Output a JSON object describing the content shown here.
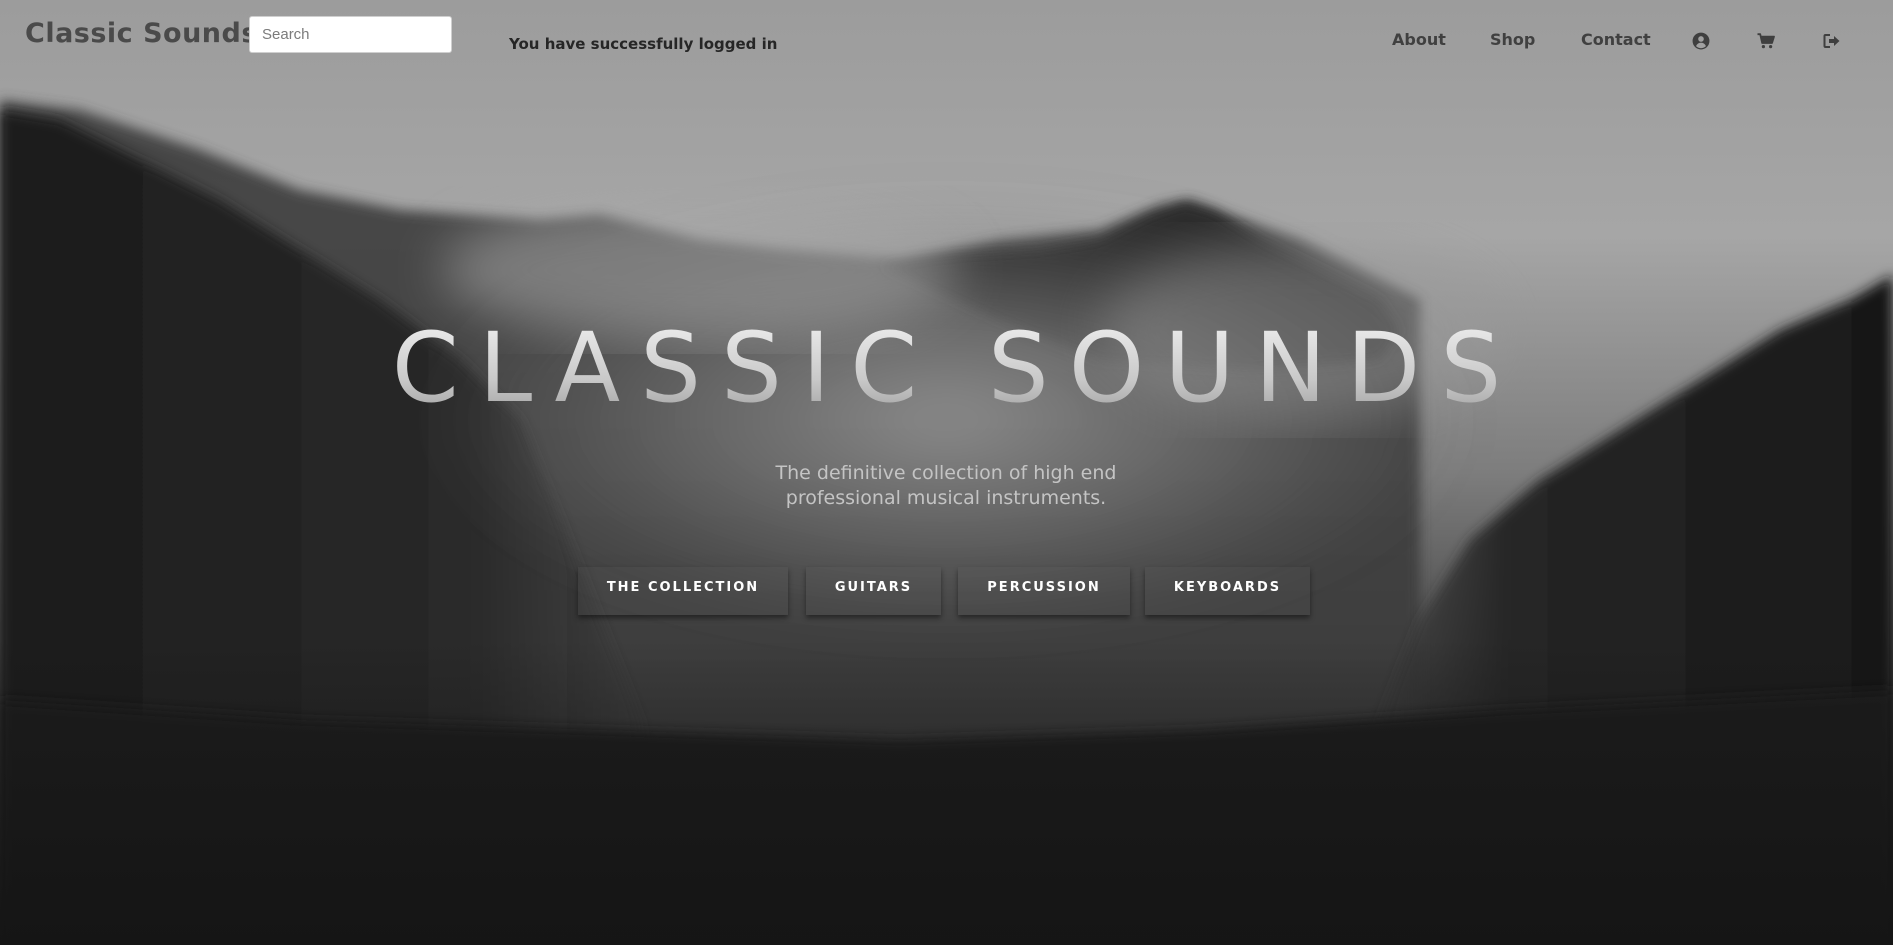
{
  "navbar": {
    "brand": "Classic Sounds",
    "search": {
      "placeholder": "Search",
      "value": ""
    },
    "message": "You have successfully logged in",
    "links": {
      "about": "About",
      "shop": "Shop",
      "contact": "Contact"
    },
    "icons": [
      "user-circle-icon",
      "shopping-cart-icon",
      "sign-out-icon"
    ]
  },
  "hero": {
    "title": "CLASSIC SOUNDS",
    "subtitle_line1": "The definitive collection of high end",
    "subtitle_line2": "professional musical instruments.",
    "buttons": {
      "collection": "THE COLLECTION",
      "guitars": "GUITARS",
      "percussion": "PERCUSSION",
      "keyboards": "KEYBOARDS"
    }
  },
  "colors": {
    "brand_text": "#4a4a4a",
    "nav_text": "#404040",
    "hero_subtitle": "#c4c4c4",
    "button_text": "#ffffff",
    "background_dark": "#151515"
  }
}
